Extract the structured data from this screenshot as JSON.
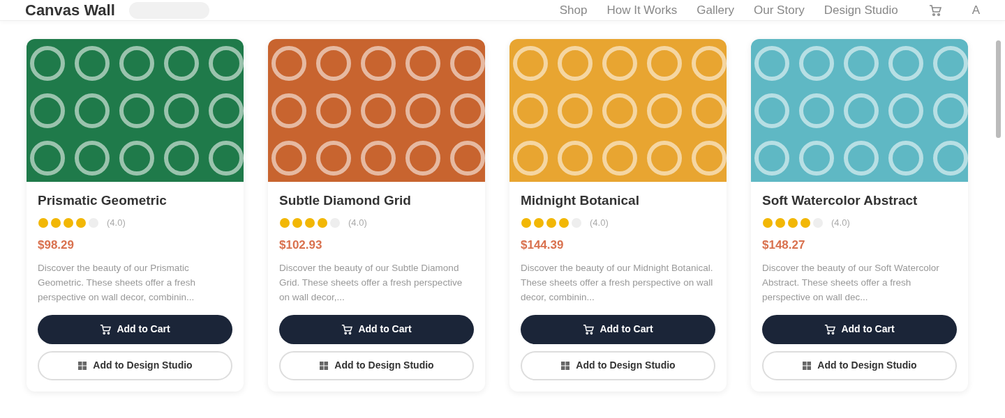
{
  "header": {
    "brand": "Canvas Wall",
    "nav": [
      "Shop",
      "How It Works",
      "Gallery",
      "Our Story",
      "Design Studio"
    ],
    "avatar": "A"
  },
  "products": [
    {
      "name": "Prismatic Geometric",
      "stars": 4,
      "rating": "(4.0)",
      "price": "$98.29",
      "description": "Discover the beauty of our Prismatic Geometric. These sheets offer a fresh perspective on wall decor, combinin...",
      "color": "#1f7a4a",
      "cart": "Add to Cart",
      "studio": "Add to Design Studio"
    },
    {
      "name": "Subtle Diamond Grid",
      "stars": 4,
      "rating": "(4.0)",
      "price": "$102.93",
      "description": "Discover the beauty of our Subtle Diamond Grid. These sheets offer a fresh perspective on wall decor,...",
      "color": "#c8642f",
      "cart": "Add to Cart",
      "studio": "Add to Design Studio"
    },
    {
      "name": "Midnight Botanical",
      "stars": 4,
      "rating": "(4.0)",
      "price": "$144.39",
      "description": "Discover the beauty of our Midnight Botanical. These sheets offer a fresh perspective on wall decor, combinin...",
      "color": "#e8a531",
      "cart": "Add to Cart",
      "studio": "Add to Design Studio"
    },
    {
      "name": "Soft Watercolor Abstract",
      "stars": 4,
      "rating": "(4.0)",
      "price": "$148.27",
      "description": "Discover the beauty of our Soft Watercolor Abstract. These sheets offer a fresh perspective on wall dec...",
      "color": "#5fb8c4",
      "cart": "Add to Cart",
      "studio": "Add to Design Studio"
    }
  ]
}
